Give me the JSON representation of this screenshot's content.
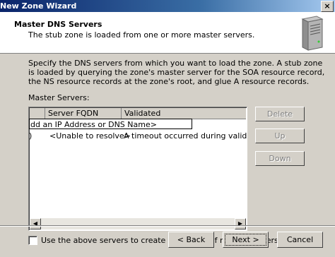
{
  "window": {
    "title": "New Zone Wizard",
    "close_glyph": "×"
  },
  "header": {
    "title": "Master DNS Servers",
    "subtitle": "The stub zone is loaded from one or more master servers.",
    "icon": "server-icon"
  },
  "content": {
    "description": "Specify the DNS servers from which you want to load the zone. A stub zone is loaded by querying the zone's master server for the SOA resource record, the NS resource records at the zone's root, and glue A resource records.",
    "master_servers_label": "Master Servers:",
    "columns": [
      "Server FQDN",
      "Validated"
    ],
    "edit_value": "dd an IP Address or DNS Name>",
    "rows": [
      {
        "marker": ")",
        "server_fqdn": "<Unable to resolve>",
        "validated": "A timeout occurred during validation."
      }
    ],
    "buttons": {
      "delete": "Delete",
      "up": "Up",
      "down": "Down"
    },
    "checkbox": {
      "label": "Use the above servers to create a local list of master servers",
      "checked": false
    }
  },
  "footer": {
    "back": "< Back",
    "next": "Next >",
    "cancel": "Cancel"
  },
  "colors": {
    "dialog_bg": "#d4d0c8",
    "titlebar": "#0a246a",
    "disabled_text": "#808080"
  }
}
